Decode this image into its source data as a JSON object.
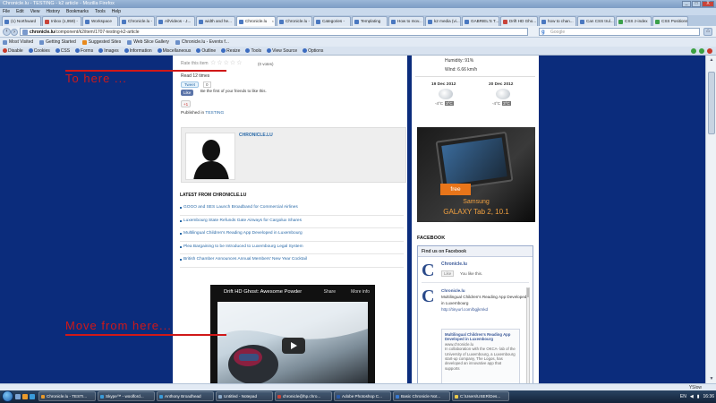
{
  "browser": {
    "title": "Chronicle.lu - TESTING - k2 article - Mozilla Firefox",
    "window_controls": [
      "_",
      "□",
      "X"
    ],
    "menu": [
      "File",
      "Edit",
      "View",
      "History",
      "Bookmarks",
      "Tools",
      "Help"
    ],
    "tabs": [
      "(1) Northward",
      "Inbox (1,959) -",
      "Workspace",
      "Chronicle.lu -",
      "AllVideos - J...",
      "width and he...",
      "Chronicle.lu",
      "Chronicle.lu -",
      "Categories -",
      "Templating",
      "How to mov...",
      "k2 media (vi...",
      "GABRIEL'S T...",
      "Drift HD Gho...",
      "how to chan...",
      "Can CSS trul...",
      "CSS z-index",
      "CSS Positions"
    ],
    "active_tab_index": 6,
    "url_domain": "chronicle.lu",
    "url_path": "/component/k2/item/1707-testing-k2-article",
    "search_placeholder": "Google",
    "bookmarks": [
      "Most Visited",
      "Getting Started",
      "Suggested Sites",
      "Web Slice Gallery",
      "Chronicle.lu - Events f..."
    ],
    "devbar": [
      "Disable",
      "Cookies",
      "CSS",
      "Forms",
      "Images",
      "Information",
      "Miscellaneous",
      "Outline",
      "Resize",
      "Tools",
      "View Source",
      "Options"
    ],
    "statusbar_right": "YSlow"
  },
  "article": {
    "rate_label": "Rate this item",
    "votes": "(0 votes)",
    "read_times": "Read 12 times",
    "tweet_label": "Tweet",
    "tweet_count": "0",
    "like_label": "Like",
    "like_first": "Be the first of your friends to like this.",
    "gplus": "+1",
    "published_in_label": "Published in",
    "published_in_value": "TESTING",
    "author_name": "CHRONICLE.LU",
    "latest_heading": "LATEST FROM CHRONICLE.LU",
    "latest_items": [
      "GOGO and SES Launch Broadband for Commercial Airlines",
      "Luxembourg State Refunds Gate Airways for Cargolux Shares",
      "Multilingual Children's Reading App Developed in Luxembourg",
      "Plea Bargaining to be Introduced to Luxembourg Legal System",
      "British Chamber Announces Annual Members' New Year Cocktail"
    ],
    "video_title": "Drift HD Ghost: Awesome Powder",
    "video_share": "Share",
    "video_more": "More info"
  },
  "sidebar": {
    "humidity": "Humidity: 91%",
    "wind": "Wind: 6.66 km/h",
    "forecast": [
      {
        "date": "19 Dec 2012",
        "low": "-4°C",
        "high": "3°C"
      },
      {
        "date": "20 Dec 2012",
        "low": "-4°C",
        "high": "3°C"
      }
    ],
    "ad_free": "free",
    "ad_brand": "Samsung",
    "ad_product": "GALAXY Tab 2, 10.1",
    "facebook_heading": "FACEBOOK",
    "fb_find_us": "Find us on Facebook",
    "fb_page_name": "Chronicle.lu",
    "fb_like": "Like",
    "fb_you_like": "You like this.",
    "fb_post_author": "Chronicle.lu",
    "fb_post_text": "Multilingual Children's Reading App Developed in Luxembourg",
    "fb_post_link": "http://tinyurl.com/bgjkmkd",
    "fb_card_title": "Multilingual Children's Reading App Developed in Luxembourg",
    "fb_card_domain": "www.chronicle.lu",
    "fb_card_text": "In collaboration with the OKCA- lab of the University of Luxembourg, a Luxembourg start-up company, The Logos, has developed an innovative app that supports"
  },
  "annotations": {
    "to_here": "To here ...",
    "move_from_here": "Move from here...",
    "color": "#d01818"
  },
  "taskbar": {
    "items": [
      "Chronicle.lu - TESTI...",
      "Skype™ - woolford...",
      "Anthony Broadhead",
      "Untitled - Notepad",
      "chronicle@hp.chro...",
      "Adobe Photoshop C...",
      "Basic Chronicle Not...",
      "C:\\Users\\USER\\Des..."
    ],
    "lang": "EN",
    "time": "16:36"
  }
}
